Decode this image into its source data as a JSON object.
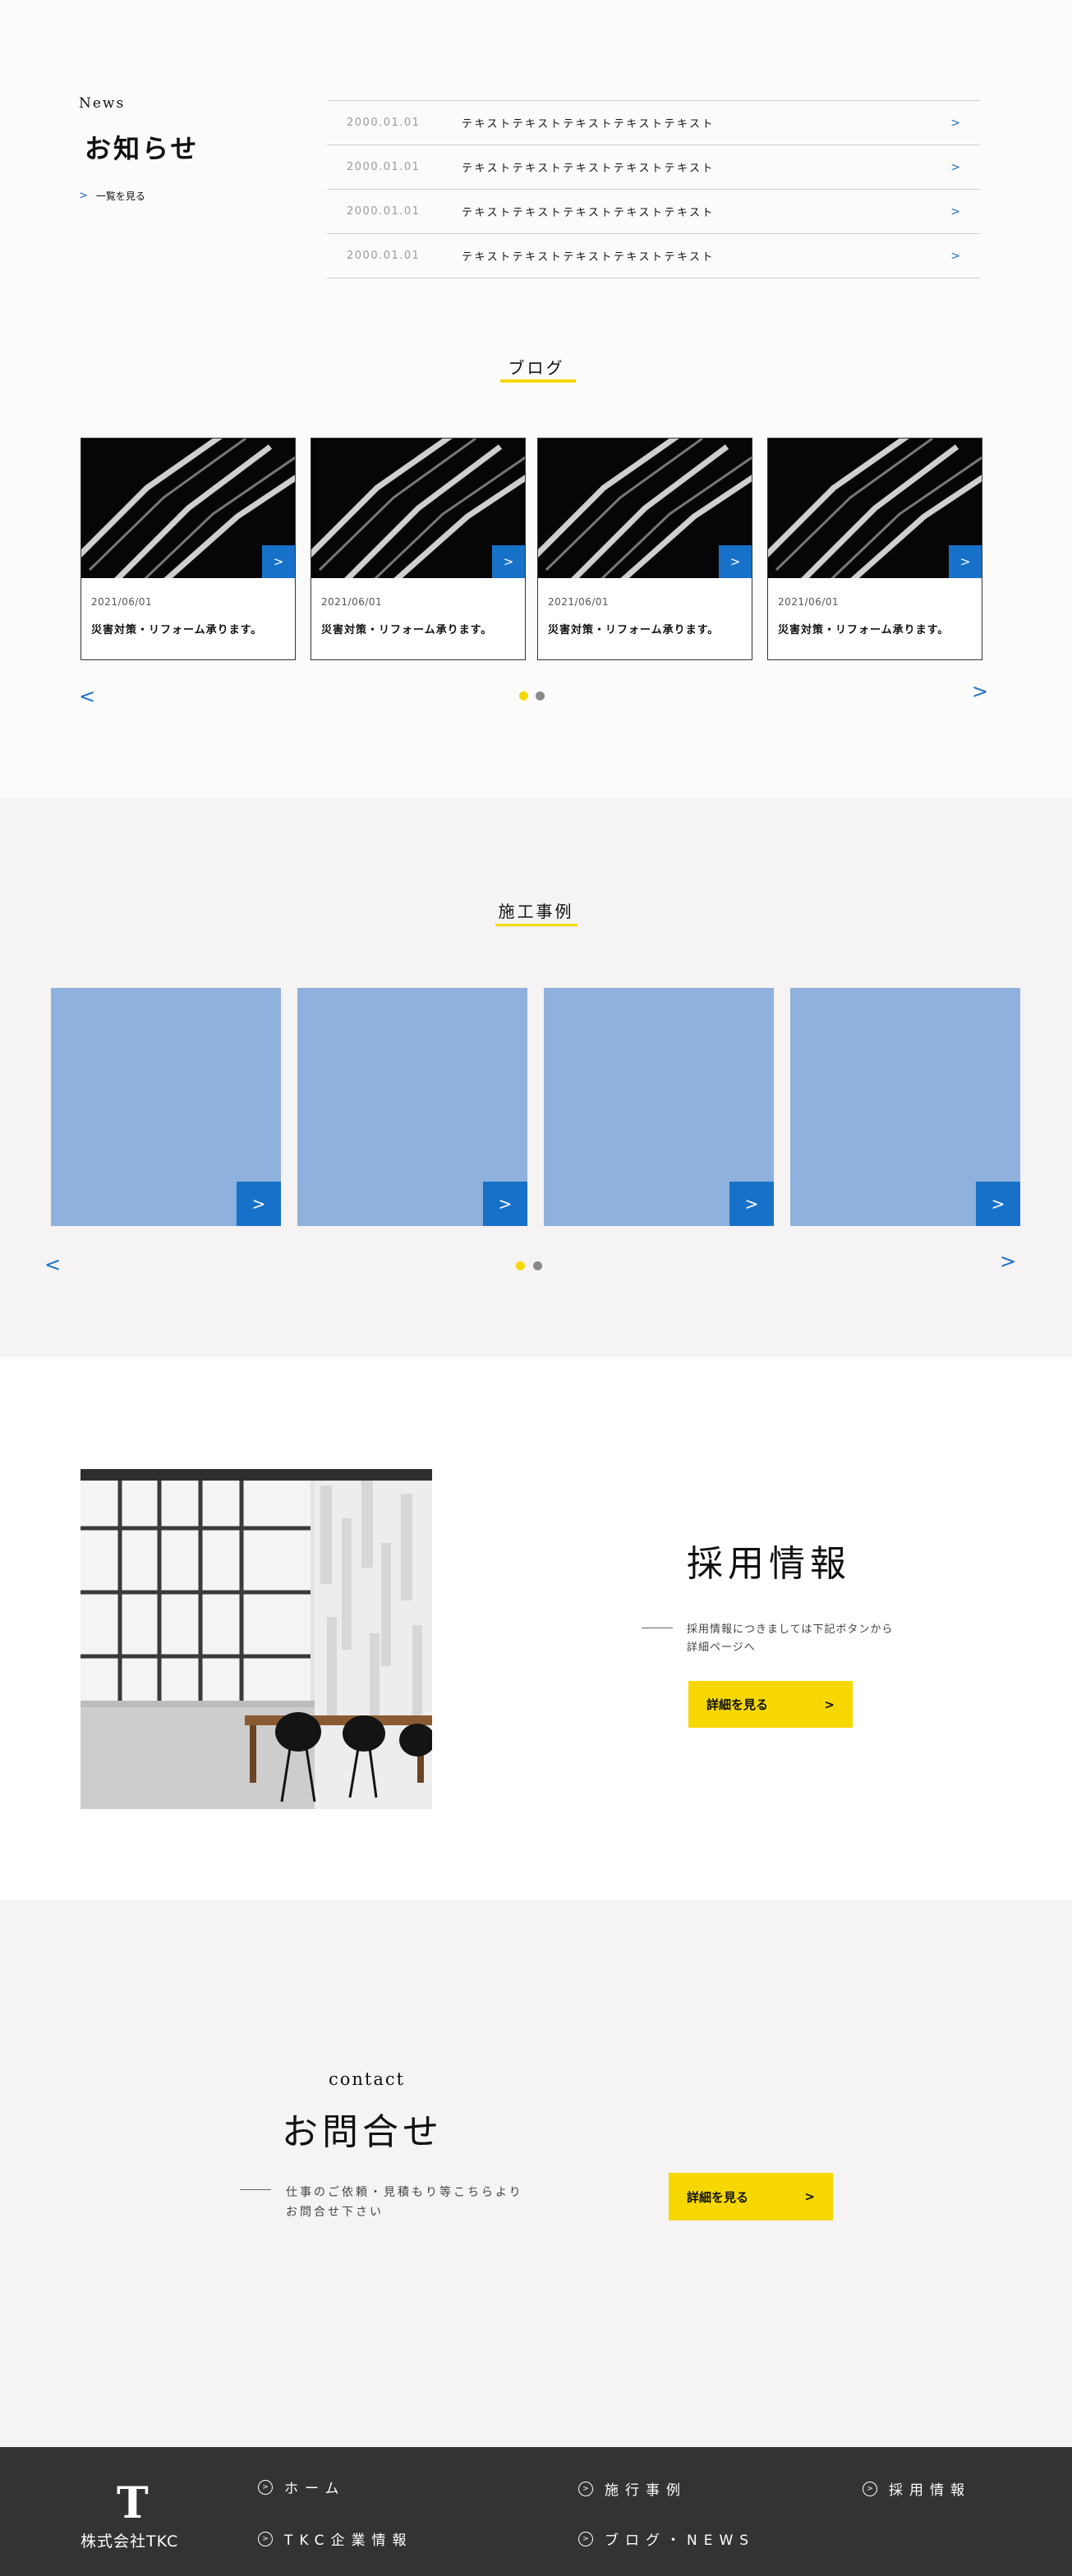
{
  "news": {
    "label_en": "News",
    "label_ja": "お知らせ",
    "more_label": "一覧を見る",
    "more_icon": "chevron-right-icon",
    "items": [
      {
        "date": "2000.01.01",
        "text": "テキストテキストテキストテキストテキスト"
      },
      {
        "date": "2000.01.01",
        "text": "テキストテキストテキストテキストテキスト"
      },
      {
        "date": "2000.01.01",
        "text": "テキストテキストテキストテキストテキスト"
      },
      {
        "date": "2000.01.01",
        "text": "テキストテキストテキストテキストテキスト"
      }
    ],
    "item_arrow": ">"
  },
  "blog": {
    "title": "ブログ",
    "cards": [
      {
        "date": "2021/06/01",
        "title": "災害対策・リフォーム承ります。"
      },
      {
        "date": "2021/06/01",
        "title": "災害対策・リフォーム承ります。"
      },
      {
        "date": "2021/06/01",
        "title": "災害対策・リフォーム承ります。"
      },
      {
        "date": "2021/06/01",
        "title": "災害対策・リフォーム承ります。"
      }
    ],
    "card_button": ">",
    "prev": "<",
    "next": ">"
  },
  "works": {
    "title": "施工事例",
    "card_button": ">",
    "prev": "<",
    "next": ">"
  },
  "recruit": {
    "title": "採用情報",
    "desc_line1": "採用情報につきましては下記ボタンから",
    "desc_line2": "詳細ページへ",
    "button_label": "詳細を見る",
    "button_arrow": ">"
  },
  "contact": {
    "label_en": "contact",
    "label_ja": "お問合せ",
    "desc_line1": "仕事のご依頼・見積もり等こちらより",
    "desc_line2": "お問合せ下さい",
    "button_label": "詳細を見る",
    "button_arrow": ">"
  },
  "footer": {
    "logo_letter": "T",
    "company": "株式会社TKC",
    "links": {
      "home": "ホーム",
      "works": "施行事例",
      "recruit": "採用情報",
      "company": "TKC企業情報",
      "blog": "ブログ・NEWS"
    }
  },
  "colors": {
    "accent_blue": "#1771c9",
    "accent_yellow": "#f6d800",
    "placeholder_blue": "#8fb1dd",
    "footer_bg": "#333333"
  }
}
